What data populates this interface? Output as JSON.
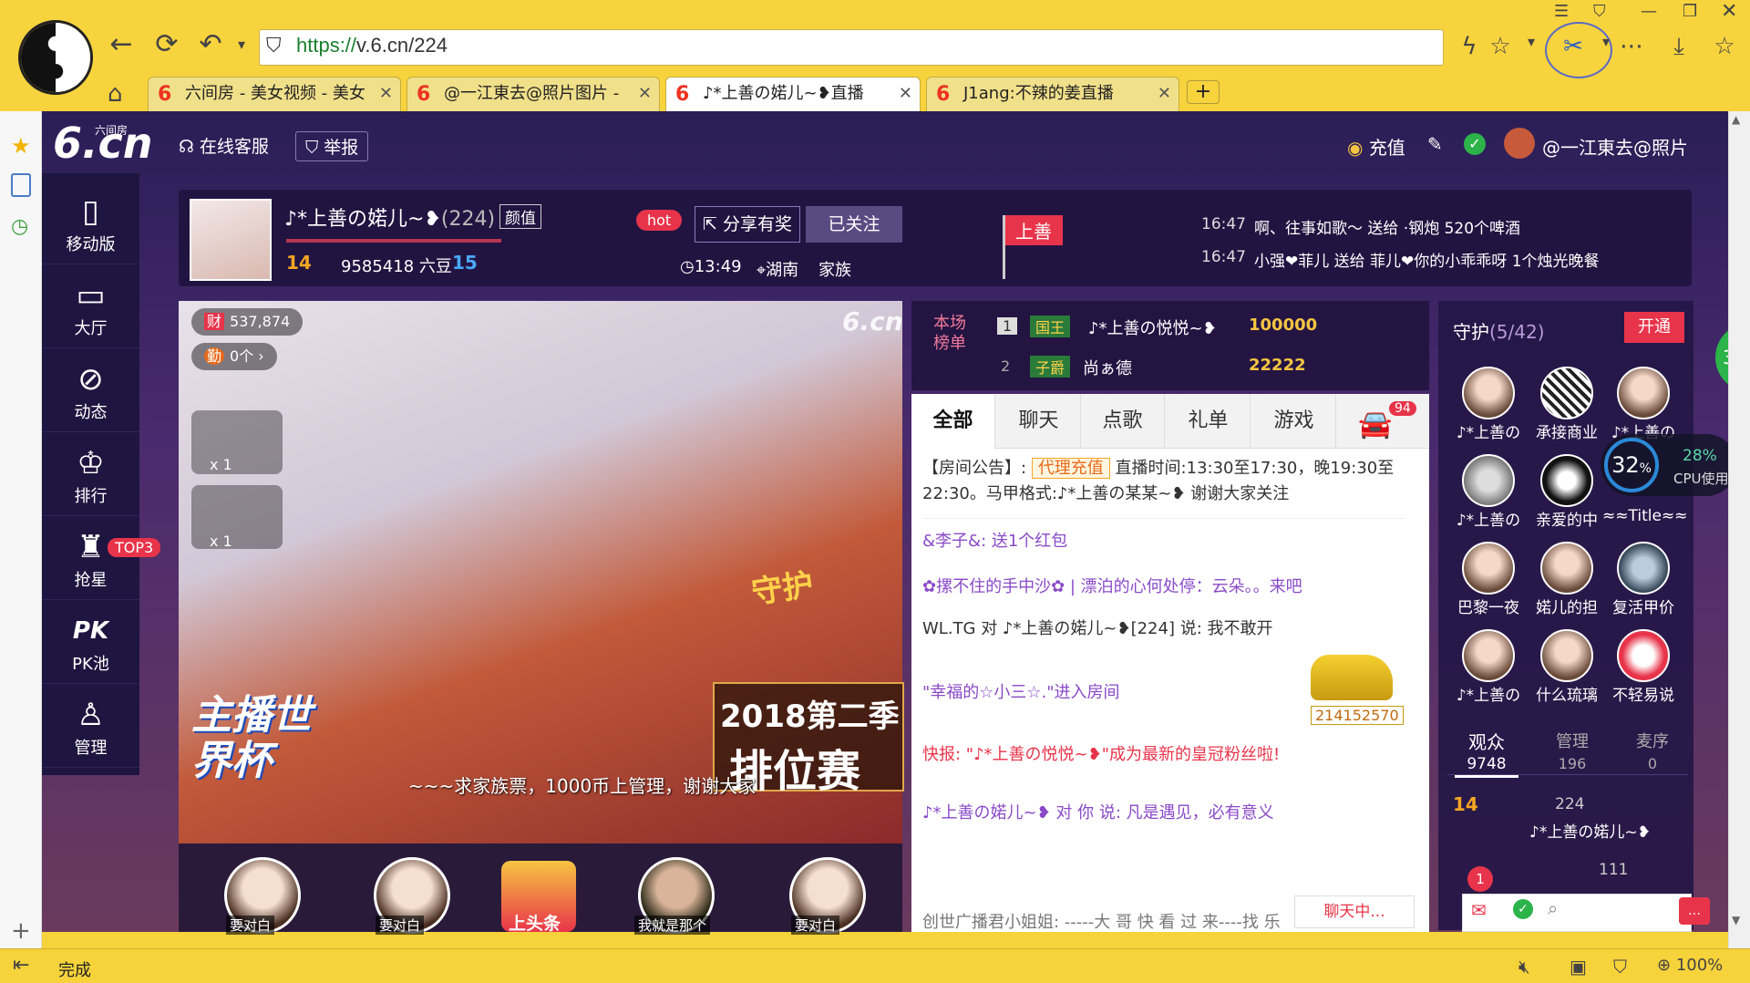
{
  "browser": {
    "url_scheme": "https://",
    "url_rest": "v.6.cn/224",
    "tabs": [
      {
        "label": "六间房 - 美女视频 - 美女",
        "active": false
      },
      {
        "label": "@一江東去@照片图片 -",
        "active": false
      },
      {
        "label": "♪*上善の婼儿~❥直播",
        "active": true
      },
      {
        "label": "J1ang:不辣的姜直播",
        "active": false
      }
    ],
    "new_tab": "+",
    "status_text": "完成",
    "zoom": "100%"
  },
  "site": {
    "logo": "6.cn",
    "logo_sub": "六间房",
    "service": "在线客服",
    "report": "举报",
    "recharge": "充值",
    "username": "@一江東去@照片",
    "nav": [
      {
        "label": "移动版",
        "icon": "phone-icon"
      },
      {
        "label": "大厅",
        "icon": "tv-icon"
      },
      {
        "label": "动态",
        "icon": "compass-icon"
      },
      {
        "label": "排行",
        "icon": "crown-icon"
      },
      {
        "label": "抢星",
        "icon": "star-cup-icon",
        "badge": "TOP3"
      },
      {
        "label": "PK池",
        "icon": "pk-icon"
      },
      {
        "label": "管理",
        "icon": "admin-icon"
      }
    ]
  },
  "anchor": {
    "name": "♪*上善の婼儿~❥",
    "room": "(224)",
    "tag": "颜值",
    "level": "14",
    "beans": "9585418 六豆",
    "fans_level": "15",
    "hot": "hot",
    "share": "分享有奖",
    "follow": "已关注",
    "time": "13:49",
    "location": "湖南",
    "family": "家族",
    "flag": "上善"
  },
  "gift_feed": [
    {
      "time": "16:47",
      "text": "啊、往事如歌～ 送给 ·钢炮 520个啤酒"
    },
    {
      "time": "16:47",
      "text": "小强❤菲儿 送给 菲儿❤你的小乖乖呀 1个烛光晚餐"
    }
  ],
  "video": {
    "wealth": "537,874",
    "diligence": "0个",
    "guard_count1": "x 1",
    "guard_count2": "x 1",
    "banner_left": "主播世界杯",
    "banner_right_top": "2018第二季",
    "banner_right_bottom": "排位赛",
    "subtitle": "~~~求家族票，1000币上管理，谢谢大家",
    "watermark": "6.cn",
    "badge": "守护"
  },
  "thumbs": [
    {
      "label": "要对白"
    },
    {
      "label": "要对白"
    },
    {
      "label": "上头条"
    },
    {
      "label": "我就是那个"
    },
    {
      "label": "要对白"
    }
  ],
  "ranking": {
    "title": "本场榜单",
    "rows": [
      {
        "rank": "1",
        "badge": "国王",
        "name": "♪*上善の悦悦~❥",
        "score": "100000"
      },
      {
        "rank": "2",
        "badge": "子爵",
        "name": "尚ぁ德",
        "score": "22222"
      }
    ]
  },
  "chat": {
    "tabs": [
      "全部",
      "聊天",
      "点歌",
      "礼单",
      "游戏"
    ],
    "car_badge": "94",
    "notice_prefix": "【房间公告】:",
    "notice_btn": "代理充值",
    "notice_text": "直播时间:13:30至17:30，晚19:30至22:30。马甲格式:♪*上善の某某~❥ 谢谢大家关注",
    "messages": [
      {
        "text": "&李子&: 送1个红包"
      },
      {
        "text": "✿摞不住的手中沙✿ | 漂泊的心何处停：云朵。。来吧"
      },
      {
        "text": "WL.TG 对 ♪*上善の婼儿~❥[224] 说: 我不敢开"
      },
      {
        "text": "\"幸福的☆小三☆.\"进入房间"
      },
      {
        "text": "快报: \"♪*上善の悦悦~❥\"成为最新的皇冠粉丝啦!"
      },
      {
        "text": "♪*上善の婼儿~❥ 对 你 说: 凡是遇见，必有意义"
      },
      {
        "text": "创世广播君小姐姐: -----大 哥 快 看 过 来----找 乐"
      }
    ],
    "car_id": "214152570",
    "chatting": "聊天中..."
  },
  "guard": {
    "title": "守护",
    "count": "(5/42)",
    "open": "开通",
    "members": [
      "♪*上善の",
      "承接商业",
      "♪*上善の",
      "♪*上善の",
      "亲爱的中",
      "≈≈Title≈≈",
      "巴黎一夜",
      "婼儿的担",
      "复活甲价",
      "♪*上善の",
      "什么琉璃",
      "不轻易说"
    ],
    "tabs": [
      {
        "label": "观众",
        "count": "9748"
      },
      {
        "label": "管理",
        "count": "196"
      },
      {
        "label": "麦序",
        "count": "0"
      }
    ],
    "viewer_level": "14",
    "viewer_room": "224",
    "viewer_name": "♪*上善の婼儿~❥",
    "viewer2_room": "111"
  },
  "cpu": {
    "percent": "32",
    "unit": "%",
    "rate": "28%",
    "label": "CPU使用",
    "edge": "32"
  }
}
